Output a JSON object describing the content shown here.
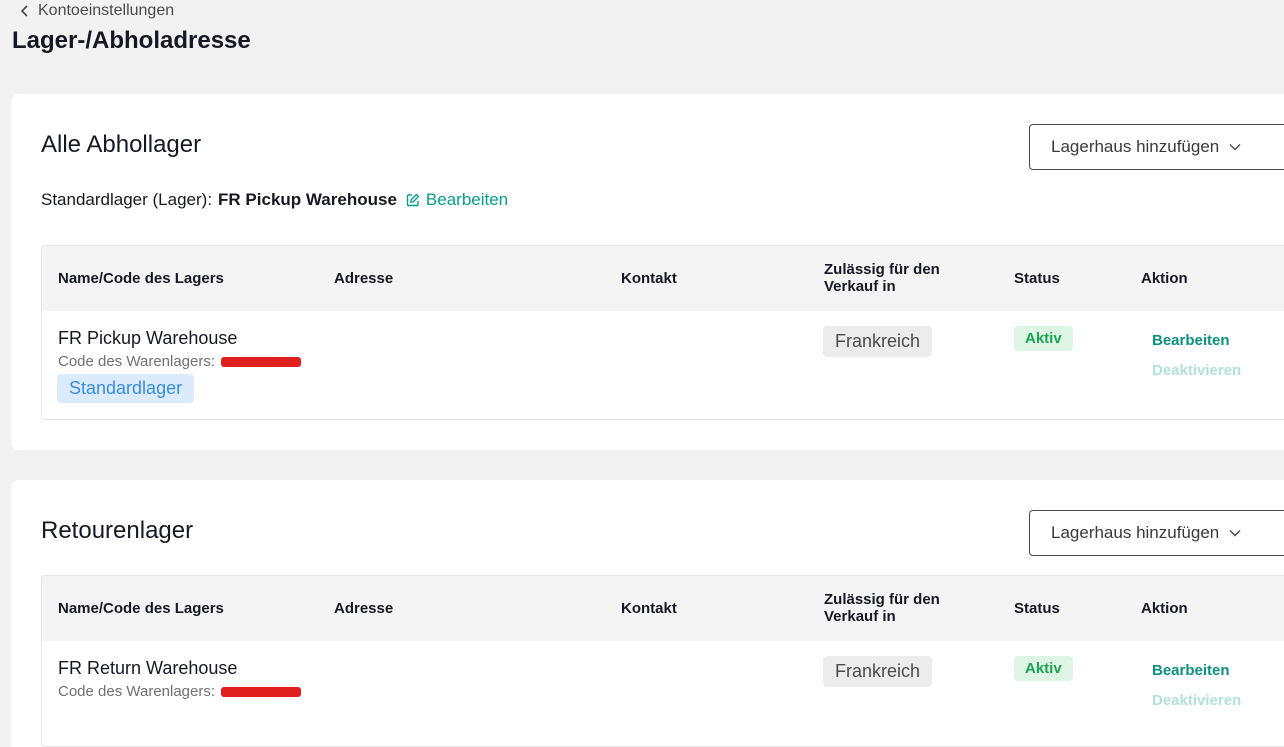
{
  "nav": {
    "back_label": "Kontoeinstellungen"
  },
  "page": {
    "title": "Lager-/Abholadresse"
  },
  "colors": {
    "accent": "#0b9a8a",
    "active_status": "#1aa352",
    "default_badge": "#3a8dde",
    "redaction": "#e01f1f"
  },
  "pickup_section": {
    "title": "Alle Abhollager",
    "add_button": "Lagerhaus hinzufügen",
    "default_label": "Standardlager (Lager):",
    "default_warehouse": "FR Pickup Warehouse",
    "edit_label": "Bearbeiten",
    "columns": [
      "Name/Code des Lagers",
      "Adresse",
      "Kontakt",
      "Zulässig für den Verkauf in",
      "Status",
      "Aktion"
    ],
    "rows": [
      {
        "name": "FR Pickup Warehouse",
        "code_label": "Code des Warenlagers:",
        "badge": "Standardlager",
        "country": "Frankreich",
        "status": "Aktiv",
        "actions": [
          "Bearbeiten",
          "Deaktivieren"
        ]
      }
    ]
  },
  "return_section": {
    "title": "Retourenlager",
    "add_button": "Lagerhaus hinzufügen",
    "columns": [
      "Name/Code des Lagers",
      "Adresse",
      "Kontakt",
      "Zulässig für den Verkauf in",
      "Status",
      "Aktion"
    ],
    "rows": [
      {
        "name": "FR Return Warehouse",
        "code_label": "Code des Warenlagers:",
        "country": "Frankreich",
        "status": "Aktiv",
        "actions": [
          "Bearbeiten",
          "Deaktivieren"
        ]
      }
    ]
  }
}
